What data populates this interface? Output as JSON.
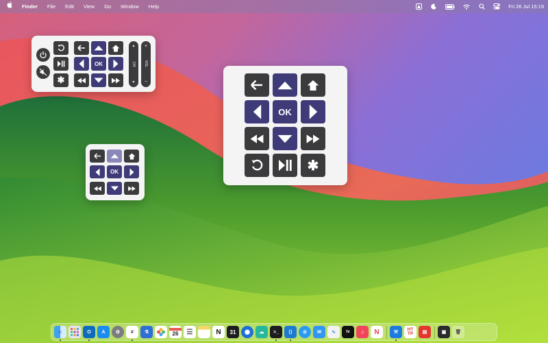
{
  "menubar": {
    "apple": "",
    "app_name": "Finder",
    "menus": [
      "File",
      "Edit",
      "View",
      "Go",
      "Window",
      "Help"
    ],
    "clock": "Fri 26 Jul  15:19",
    "status_icons": [
      "contrast-icon",
      "moon-icon",
      "battery-icon",
      "wifi-icon",
      "search-icon",
      "control-center-icon"
    ]
  },
  "remote_full": {
    "ok_label": "OK",
    "volume_plus": "+",
    "volume_label": "VOL",
    "volume_minus": "−",
    "channel_label": "CH",
    "buttons": [
      "power-icon",
      "mute-icon",
      "replay-icon",
      "play-pause-icon",
      "asterisk-icon",
      "back-arrow-icon",
      "up-arrow-icon",
      "home-icon",
      "left-arrow-icon",
      "right-arrow-icon",
      "rewind-icon",
      "down-arrow-icon",
      "fast-forward-icon"
    ]
  },
  "remote_small": {
    "ok_label": "OK",
    "buttons": [
      "back-arrow-icon",
      "up-arrow-icon",
      "home-icon",
      "left-arrow-icon",
      "right-arrow-icon",
      "rewind-icon",
      "down-arrow-icon",
      "fast-forward-icon"
    ]
  },
  "remote_large": {
    "ok_label": "OK",
    "buttons": [
      "back-arrow-icon",
      "up-arrow-icon",
      "home-icon",
      "left-arrow-icon",
      "right-arrow-icon",
      "rewind-icon",
      "down-arrow-icon",
      "fast-forward-icon",
      "replay-icon",
      "play-pause-icon",
      "asterisk-icon"
    ]
  },
  "dock": {
    "calendar_day": "26",
    "calendar_day_small": "31",
    "http_label_top": "HT",
    "http_label_bottom": "TP",
    "apps": [
      "finder",
      "launchpad",
      "outlook",
      "app-store",
      "system-settings",
      "slack",
      "instruments",
      "photos",
      "calendar",
      "reminders",
      "notes",
      "notion",
      "calendar-31",
      "maps-pin",
      "copilot",
      "terminal",
      "vscode",
      "safari",
      "mail",
      "activity-monitor",
      "apple-tv",
      "music",
      "news",
      "xcode",
      "http-toolkit",
      "server",
      "photo-viewer",
      "trash"
    ]
  },
  "colors": {
    "dark_button": "#3b3b3d",
    "purple_button": "#3e3b78",
    "light_purple_button": "#8a86b8",
    "panel_bg": "#f4f4f5"
  }
}
